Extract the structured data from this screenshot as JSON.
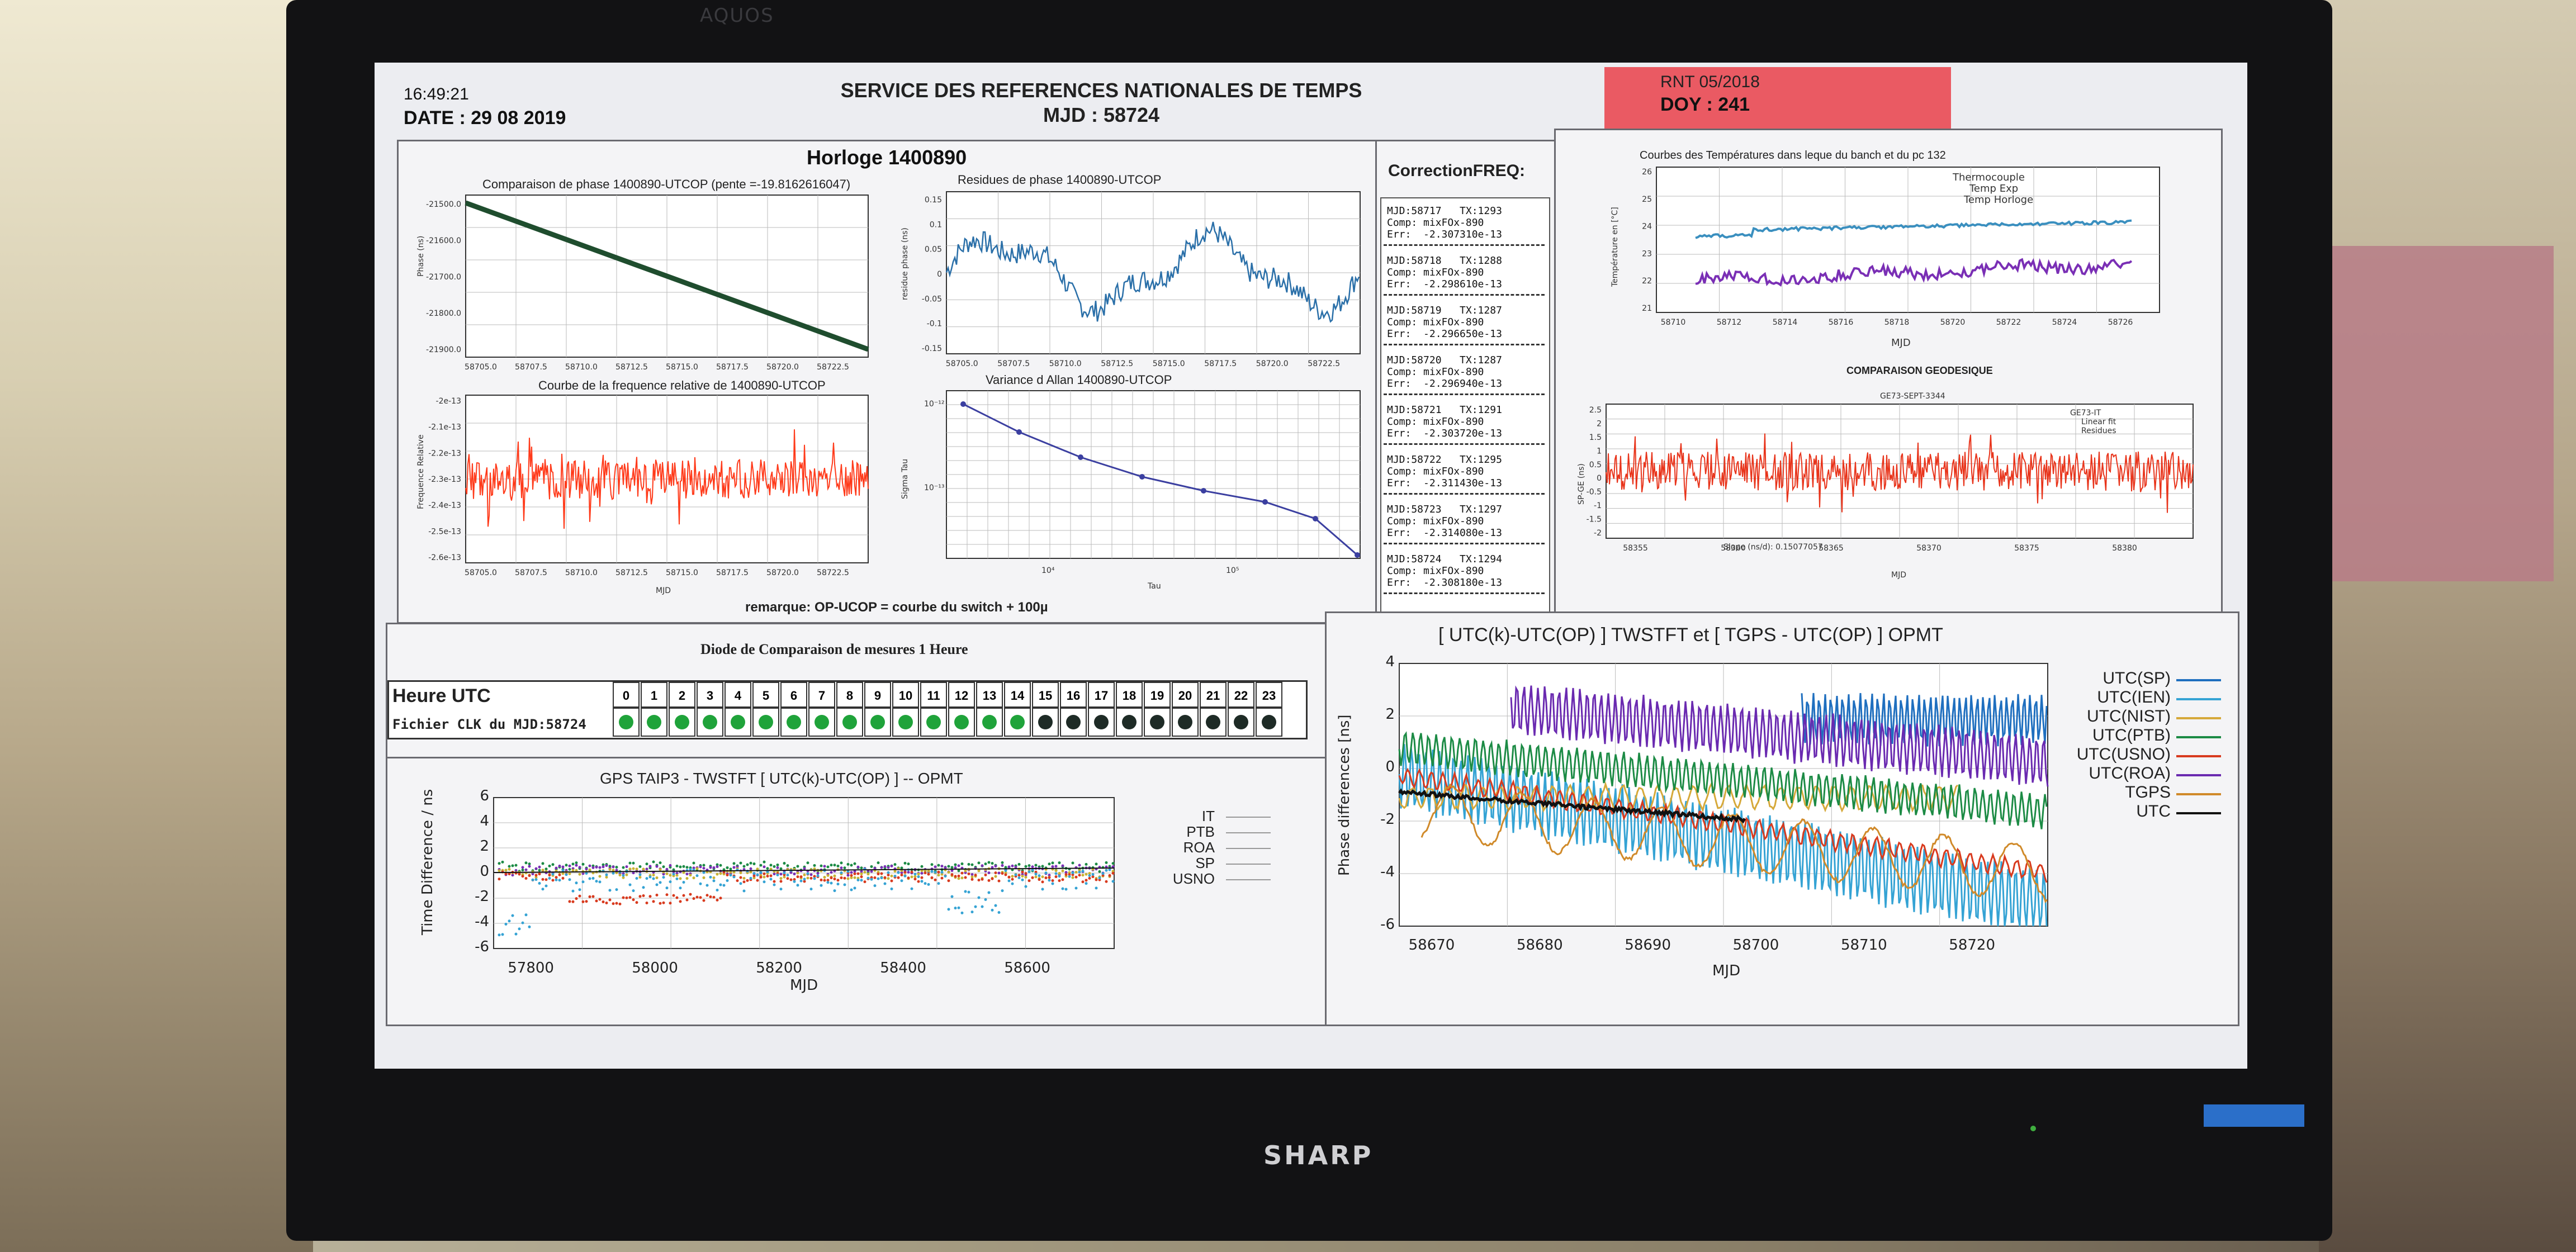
{
  "monitor": {
    "brand_top": "AQUOS",
    "brand": "SHARP"
  },
  "header": {
    "time": "16:49:21",
    "date": "DATE : 29 08 2019",
    "title": "SERVICE DES REFERENCES NATIONALES DE TEMPS",
    "mjd": "MJD : 58724",
    "rnt": "RNT 05/2018",
    "doy": "DOY : 241",
    "red_color": "#ea5a63"
  },
  "horloge": {
    "title": "Horloge 1400890",
    "remark": "remarque: OP-UCOP = courbe du switch + 100µ",
    "phase": {
      "title": "Comparaison de phase 1400890-UTCOP (pente =-19.8162616047)",
      "ylabel": "Phase (ns)",
      "yticks": [
        "-21500.0",
        "-21600.0",
        "-21700.0",
        "-21800.0",
        "-21900.0"
      ],
      "xticks": [
        "58705.0",
        "58707.5",
        "58710.0",
        "58712.5",
        "58715.0",
        "58717.5",
        "58720.0",
        "58722.5"
      ],
      "color": "#1f4d2e"
    },
    "freq": {
      "title": "Courbe de la frequence relative de 1400890-UTCOP",
      "ylabel": "Frequence Relative",
      "xlabel": "MJD",
      "yticks": [
        "-2e-13",
        "-2.1e-13",
        "-2.2e-13",
        "-2.3e-13",
        "-2.4e-13",
        "-2.5e-13",
        "-2.6e-13"
      ],
      "xticks": [
        "58705.0",
        "58707.5",
        "58710.0",
        "58712.5",
        "58715.0",
        "58717.5",
        "58720.0",
        "58722.5"
      ],
      "color": "#ff3a1a"
    },
    "residue": {
      "title": "Residues de phase 1400890-UTCOP",
      "ylabel": "residue phase (ns)",
      "yticks": [
        "0.15",
        "0.1",
        "0.05",
        "0",
        "-0.05",
        "-0.1",
        "-0.15"
      ],
      "xticks": [
        "58705.0",
        "58707.5",
        "58710.0",
        "58712.5",
        "58715.0",
        "58717.5",
        "58720.0",
        "58722.5"
      ],
      "color": "#2a6fa8"
    },
    "allan": {
      "title": "Variance d Allan 1400890-UTCOP",
      "ylabel": "Sigma Tau",
      "xlabel": "Tau",
      "yticks": [
        "10⁻¹²",
        "10⁻¹³"
      ],
      "xticks": [
        "10⁴",
        "10⁵"
      ],
      "color": "#3b3fa0"
    }
  },
  "correction": {
    "title": "CorrectionFREQ:",
    "entries": [
      {
        "mjd": "MJD:58717   TX:1293",
        "comp": "Comp: mixFOx-890",
        "err": "Err:  -2.307310e-13"
      },
      {
        "mjd": "MJD:58718   TX:1288",
        "comp": "Comp: mixFOx-890",
        "err": "Err:  -2.298610e-13"
      },
      {
        "mjd": "MJD:58719   TX:1287",
        "comp": "Comp: mixFOx-890",
        "err": "Err:  -2.296650e-13"
      },
      {
        "mjd": "MJD:58720   TX:1287",
        "comp": "Comp: mixFOx-890",
        "err": "Err:  -2.296940e-13"
      },
      {
        "mjd": "MJD:58721   TX:1291",
        "comp": "Comp: mixFOx-890",
        "err": "Err:  -2.303720e-13"
      },
      {
        "mjd": "MJD:58722   TX:1295",
        "comp": "Comp: mixFOx-890",
        "err": "Err:  -2.311430e-13"
      },
      {
        "mjd": "MJD:58723   TX:1297",
        "comp": "Comp: mixFOx-890",
        "err": "Err:  -2.314080e-13"
      },
      {
        "mjd": "MJD:58724   TX:1294",
        "comp": "Comp: mixFOx-890",
        "err": "Err:  -2.308180e-13"
      }
    ]
  },
  "temperature": {
    "title": "Courbes des Températures dans leque du banch et du pc 132",
    "ylabel": "Température en [°C]",
    "xlabel": "MJD",
    "legend": [
      "Thermocouple",
      "Temp Exp",
      "Temp Horloge"
    ],
    "yticks": [
      "26",
      "25",
      "24",
      "23",
      "22",
      "21"
    ],
    "xticks": [
      "58710",
      "58712",
      "58714",
      "58716",
      "58718",
      "58720",
      "58722",
      "58724",
      "58726"
    ],
    "colors": [
      "#3a8fbf",
      "#7a2fb5"
    ]
  },
  "geodesique": {
    "title": "COMPARAISON GEODESIQUE",
    "subtitle": "GE73-SEPT-3344",
    "slope": "Slope (ns/d): 0.15077057",
    "legend": [
      "GE73-IT",
      "Linear fit",
      "Residues"
    ],
    "ylabel": "SP-GE (ns)",
    "xlabel": "MJD",
    "yticks": [
      "2.5",
      "2",
      "1.5",
      "1",
      "0.5",
      "0",
      "-0.5",
      "-1",
      "-1.5",
      "-2"
    ],
    "xticks": [
      "58355",
      "58360",
      "58365",
      "58370",
      "58375",
      "58380"
    ],
    "color": "#e8341b"
  },
  "diode": {
    "title": "Diode de Comparaison de mesures 1 Heure",
    "row1_label": "Heure UTC",
    "row2_label": "Fichier CLK du MJD:58724",
    "hours": [
      "0",
      "1",
      "2",
      "3",
      "4",
      "5",
      "6",
      "7",
      "8",
      "9",
      "10",
      "11",
      "12",
      "13",
      "14",
      "15",
      "16",
      "17",
      "18",
      "19",
      "20",
      "21",
      "22",
      "23"
    ],
    "status": [
      "on",
      "on",
      "on",
      "on",
      "on",
      "on",
      "on",
      "on",
      "on",
      "on",
      "on",
      "on",
      "on",
      "on",
      "on",
      "off",
      "off",
      "off",
      "off",
      "off",
      "off",
      "off",
      "off",
      "off"
    ],
    "on_color": "#1fa33a",
    "off_color": "#1e2b26"
  },
  "gps": {
    "title": "GPS TAIP3 - TWSTFT [ UTC(k)-UTC(OP) ] -- OPMT",
    "ylabel": "Time Difference / ns",
    "xlabel": "MJD",
    "yticks": [
      "6",
      "4",
      "2",
      "0",
      "-2",
      "-4",
      "-6"
    ],
    "xticks": [
      "57800",
      "58000",
      "58200",
      "58400",
      "58600"
    ],
    "legend": [
      "IT",
      "PTB",
      "ROA",
      "SP",
      "USNO"
    ]
  },
  "twstft": {
    "title": "[ UTC(k)-UTC(OP) ] TWSTFT  et [ TGPS - UTC(OP) ] OPMT",
    "ylabel": "Phase differences [ns]",
    "xlabel": "MJD",
    "yticks": [
      "4",
      "2",
      "0",
      "-2",
      "-4",
      "-6"
    ],
    "xticks": [
      "58670",
      "58680",
      "58690",
      "58700",
      "58710",
      "58720"
    ],
    "legend": [
      {
        "name": "UTC(SP)",
        "color": "#1f6fbf"
      },
      {
        "name": "UTC(IEN)",
        "color": "#35a3d4"
      },
      {
        "name": "UTC(NIST)",
        "color": "#d6a93a"
      },
      {
        "name": "UTC(PTB)",
        "color": "#1c8b45"
      },
      {
        "name": "UTC(USNO)",
        "color": "#d83a1e"
      },
      {
        "name": "UTC(ROA)",
        "color": "#6a2ab0"
      },
      {
        "name": "TGPS",
        "color": "#d08a2a"
      },
      {
        "name": "UTC",
        "color": "#111111"
      }
    ]
  }
}
